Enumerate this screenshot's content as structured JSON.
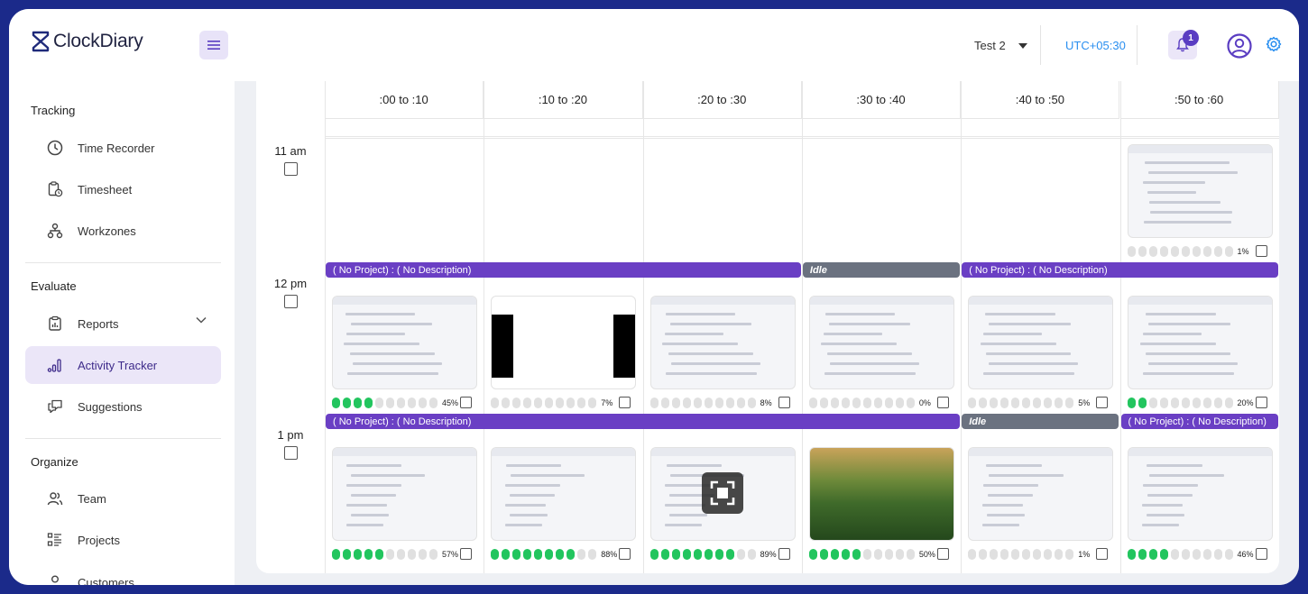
{
  "app": {
    "name": "ClockDiary"
  },
  "header": {
    "workspace": "Test 2",
    "timezone": "UTC+05:30",
    "notifications_count": "1"
  },
  "sidebar": {
    "sections": [
      {
        "title": "Tracking",
        "items": [
          {
            "label": "Time Recorder",
            "icon": "clock-icon"
          },
          {
            "label": "Timesheet",
            "icon": "clipboard-clock-icon"
          },
          {
            "label": "Workzones",
            "icon": "network-icon"
          }
        ]
      },
      {
        "title": "Evaluate",
        "items": [
          {
            "label": "Reports",
            "icon": "report-icon",
            "expandable": true
          },
          {
            "label": "Activity Tracker",
            "icon": "bar-chart-icon",
            "active": true
          },
          {
            "label": "Suggestions",
            "icon": "chat-icon"
          }
        ]
      },
      {
        "title": "Organize",
        "items": [
          {
            "label": "Team",
            "icon": "team-icon"
          },
          {
            "label": "Projects",
            "icon": "list-icon"
          },
          {
            "label": "Customers",
            "icon": "user-icon"
          }
        ]
      }
    ]
  },
  "tracker": {
    "columns": [
      ":00 to :10",
      ":10 to :20",
      ":20 to :30",
      ":30 to :40",
      ":40 to :50",
      ":50 to :60"
    ],
    "hours": [
      {
        "label": "11 am",
        "bars": [],
        "cells": [
          null,
          null,
          null,
          null,
          null,
          {
            "dots": 0,
            "pct": "1%"
          }
        ]
      },
      {
        "label": "12 pm",
        "bars": [
          {
            "text": "( No Project) : ( No Description)",
            "start": 0,
            "span": 3,
            "idle": false
          },
          {
            "text": "Idle",
            "start": 3,
            "span": 1,
            "idle": true
          },
          {
            "text": "( No Project) : ( No Description)",
            "start": 4,
            "span": 2,
            "idle": false
          }
        ],
        "cells": [
          {
            "dots": 4,
            "pct": "45%"
          },
          {
            "dots": 0,
            "pct": "7%"
          },
          {
            "dots": 0,
            "pct": "8%"
          },
          {
            "dots": 0,
            "pct": "0%"
          },
          {
            "dots": 0,
            "pct": "5%"
          },
          {
            "dots": 2,
            "pct": "20%"
          }
        ]
      },
      {
        "label": "1 pm",
        "bars": [
          {
            "text": "( No Project) : ( No Description)",
            "start": 0,
            "span": 4,
            "idle": false
          },
          {
            "text": "Idle",
            "start": 4,
            "span": 1,
            "idle": true
          },
          {
            "text": "( No Project) : ( No Description)",
            "start": 5,
            "span": 1,
            "idle": false
          }
        ],
        "cells": [
          {
            "dots": 5,
            "pct": "57%"
          },
          {
            "dots": 8,
            "pct": "88%"
          },
          {
            "dots": 8,
            "pct": "89%"
          },
          {
            "dots": 5,
            "pct": "50%"
          },
          {
            "dots": 0,
            "pct": "1%"
          },
          {
            "dots": 4,
            "pct": "46%"
          }
        ]
      }
    ]
  },
  "colors": {
    "accent": "#6a3fc4",
    "idle": "#6b7280",
    "active_dot": "#22c55e",
    "link": "#2a8ff0"
  }
}
